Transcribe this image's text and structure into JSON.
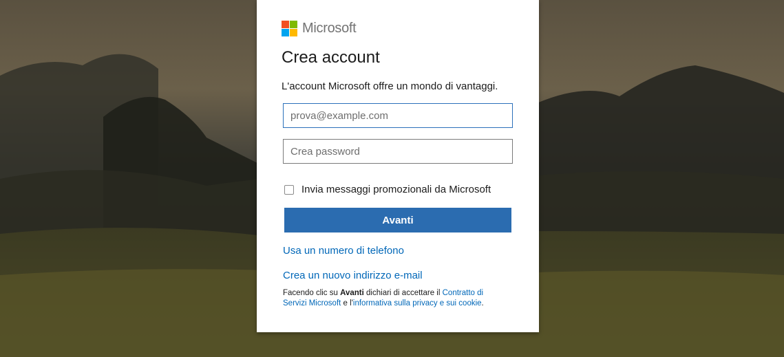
{
  "brand": {
    "name": "Microsoft",
    "logo_colors": [
      "#f25022",
      "#7fba00",
      "#00a4ef",
      "#ffb900"
    ]
  },
  "form": {
    "title": "Crea account",
    "subtitle": "L'account Microsoft offre un mondo di vantaggi.",
    "email": {
      "value": "",
      "placeholder": "prova@example.com"
    },
    "password": {
      "value": "",
      "placeholder": "Crea password"
    },
    "promo_checkbox": {
      "label": "Invia messaggi promozionali da Microsoft",
      "checked": false
    },
    "next_button": "Avanti",
    "phone_link": "Usa un numero di telefono",
    "new_email_link": "Crea un nuovo indirizzo e-mail",
    "legal": {
      "prefix": "Facendo clic su ",
      "bold": "Avanti",
      "middle": " dichiari di accettare il ",
      "terms_link": "Contratto di Servizi Microsoft",
      "joiner": " e l'",
      "privacy_link": "informativa sulla privacy e sui cookie",
      "suffix": "."
    }
  },
  "colors": {
    "accent": "#2b6cb0",
    "link": "#0067b8"
  }
}
